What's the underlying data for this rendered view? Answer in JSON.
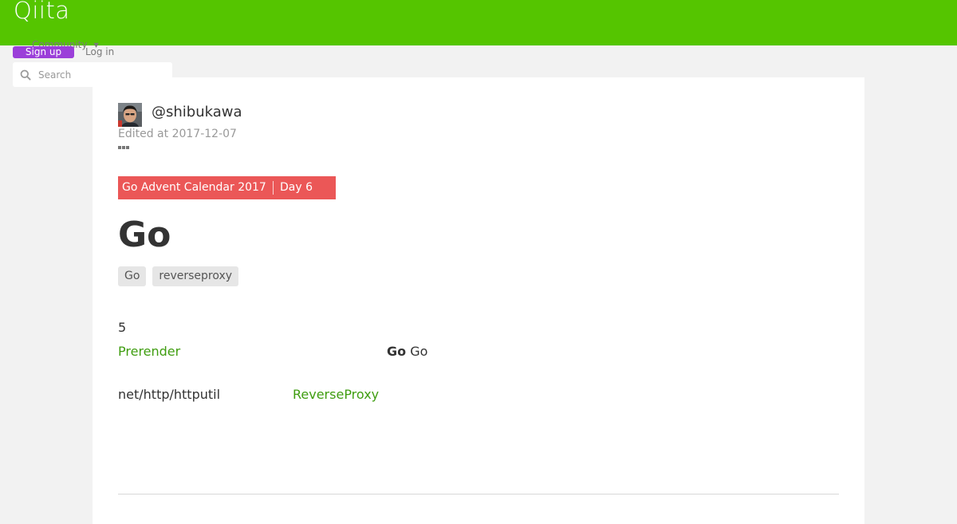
{
  "header": {
    "logo": "Qiita",
    "community_label": "Community",
    "signup_label": "Sign up",
    "login_label": "Log in"
  },
  "search": {
    "placeholder": "Search"
  },
  "article": {
    "author": "@shibukawa",
    "edited": "Edited at 2017-12-07",
    "calendar": {
      "name": "Go Advent Calendar 2017",
      "day": "Day 6"
    },
    "title": "Go",
    "tags": [
      "Go",
      "reverseproxy"
    ],
    "body": {
      "line1": "5",
      "link_prerender": "Prerender",
      "go_bold": "Go",
      "go_plain": "Go",
      "pkg": "net/http/httputil",
      "link_reverseproxy": "ReverseProxy"
    }
  },
  "colors": {
    "brand_green": "#55c500",
    "signup_purple": "#9b3fd9",
    "calendar_red": "#eb5757",
    "link_green": "#3f9d10"
  }
}
